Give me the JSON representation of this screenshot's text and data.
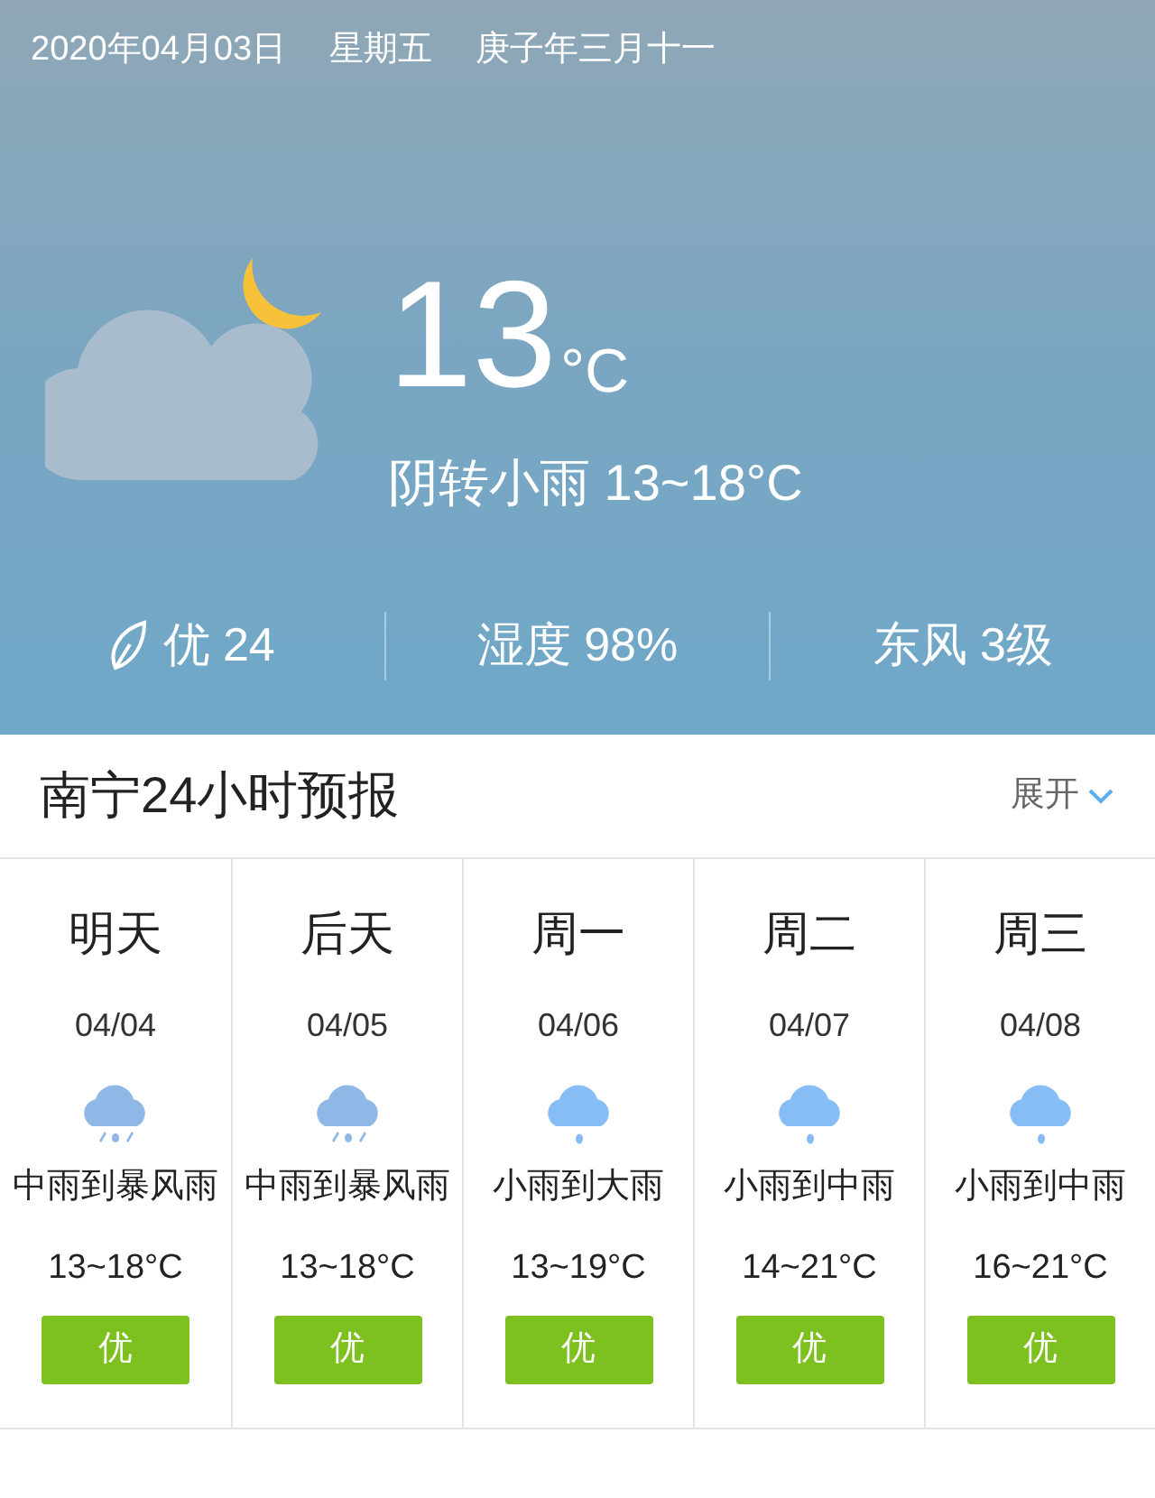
{
  "header": {
    "date": "2020年04月03日",
    "weekday": "星期五",
    "lunar_date": "庚子年三月十一",
    "temperature": "13",
    "unit": "°C",
    "condition": "阴转小雨 13~18°C",
    "stats": [
      {
        "kind": "air",
        "text": "优 24"
      },
      {
        "kind": "plain",
        "text": "湿度 98%"
      },
      {
        "kind": "plain",
        "text": "东风 3级"
      }
    ]
  },
  "forecast": {
    "title": "南宁24小时预报",
    "expand_label": "展开",
    "days": [
      {
        "day": "明天",
        "date": "04/04",
        "kind": "heavy-rain",
        "condition": "中雨到暴风雨",
        "temps": "13~18°C",
        "air": "优"
      },
      {
        "day": "后天",
        "date": "04/05",
        "kind": "heavy-rain",
        "condition": "中雨到暴风雨",
        "temps": "13~18°C",
        "air": "优"
      },
      {
        "day": "周一",
        "date": "04/06",
        "kind": "light-rain",
        "condition": "小雨到大雨",
        "temps": "13~19°C",
        "air": "优"
      },
      {
        "day": "周二",
        "date": "04/07",
        "kind": "light-rain",
        "condition": "小雨到中雨",
        "temps": "14~21°C",
        "air": "优"
      },
      {
        "day": "周三",
        "date": "04/08",
        "kind": "light-rain",
        "condition": "小雨到中雨",
        "temps": "16~21°C",
        "air": "优"
      }
    ]
  }
}
